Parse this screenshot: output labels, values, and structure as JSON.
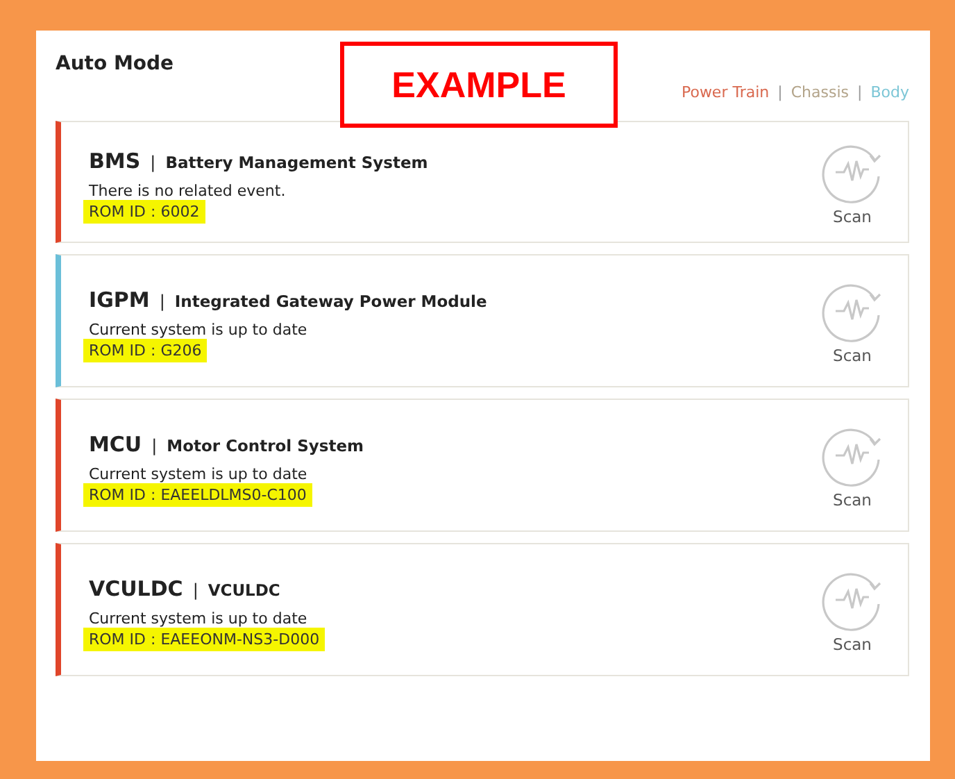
{
  "title": "Auto Mode",
  "stamp": "EXAMPLE",
  "legend": [
    {
      "label": "Power Train",
      "color": "#d9694f"
    },
    {
      "separator": "|",
      "label": "Chassis",
      "color": "#b3a48a"
    },
    {
      "separator": "|",
      "label": "Body",
      "color": "#7cc6d6"
    }
  ],
  "modules": [
    {
      "code": "BMS",
      "separator": "|",
      "name": "Battery Management System",
      "status": "There is no related event.",
      "rom_id": "ROM ID : 6002",
      "highlighted": true,
      "color": "#e0452a",
      "action": "Scan"
    },
    {
      "code": "IGPM",
      "separator": "|",
      "name": "Integrated Gateway Power Module",
      "status": "Current system is up to date",
      "rom_id": "ROM ID : G206",
      "highlighted": true,
      "color": "#6bbfd9",
      "action": "Scan"
    },
    {
      "code": "MCU",
      "separator": "|",
      "name": "Motor Control System",
      "status": "Current system is up to date",
      "rom_id": "ROM ID : EAEELDLMS0-C100",
      "highlighted": true,
      "color": "#e0452a",
      "action": "Scan"
    },
    {
      "code": "VCULDC",
      "separator": "|",
      "name": "VCULDC",
      "status": "Current system is up to date",
      "rom_id": "ROM ID : EAEEONM-NS3-D000",
      "highlighted": true,
      "color": "#e0452a",
      "action": "Scan"
    }
  ]
}
